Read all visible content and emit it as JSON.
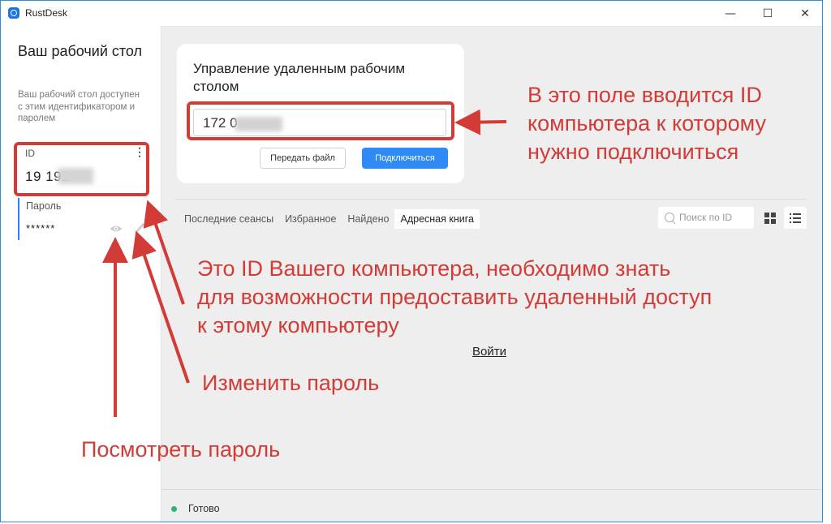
{
  "window": {
    "title": "RustDesk",
    "controls": {
      "minimize": "—",
      "maximize": "☐",
      "close": "✕"
    }
  },
  "sidebar": {
    "title": "Ваш рабочий стол",
    "description": "Ваш рабочий стол доступен с этим идентификатором и паролем",
    "id_label": "ID",
    "id_menu": "⋮",
    "id_value": "19          192",
    "password_label": "Пароль",
    "password_value": "******"
  },
  "connect_card": {
    "title": "Управление удаленным рабочим столом",
    "id_input_value": "172            0",
    "transfer_button": "Передать файл",
    "connect_button": "Подключиться"
  },
  "tabs": [
    "Последние сеансы",
    "Избранное",
    "Найдено",
    "Адресная книга"
  ],
  "active_tab_index": 3,
  "search": {
    "placeholder": "Поиск по ID"
  },
  "login_link": "Войти",
  "status": {
    "text": "Готово",
    "color": "#2bb673"
  },
  "annotations": {
    "id_field": [
      "В это поле вводится ID",
      "компьютера к которому",
      "нужно подключиться"
    ],
    "your_id": [
      "Это ID Вашего компьютера, необходимо знать",
      "для возможности предоставить удаленный доступ",
      "к этому компьютеру"
    ],
    "change_password": "Изменить пароль",
    "view_password": "Посмотреть пароль"
  },
  "colors": {
    "accent": "#2f8af5",
    "annotation": "#d23b36"
  }
}
